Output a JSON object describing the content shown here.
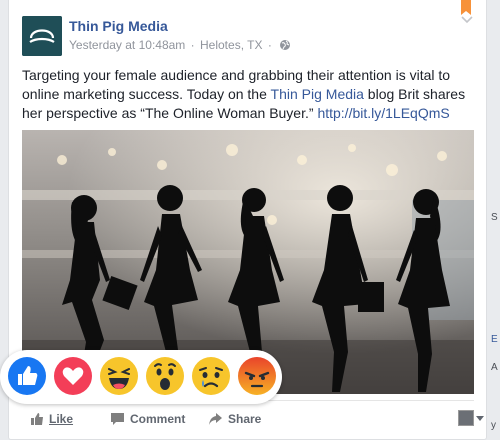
{
  "post": {
    "page_name": "Thin Pig Media",
    "timestamp": "Yesterday at 10:48am",
    "location": "Helotes, TX",
    "separator": "·",
    "privacy_icon": "globe-icon",
    "text_part1": "Targeting your female audience and grabbing their attention is vital to online marketing success. Today on the ",
    "text_link": "Thin Pig Media",
    "text_part2": " blog Brit shares her perspective as “The Online Woman Buyer.” ",
    "url": "http://bit.ly/1LEqQmS"
  },
  "reactions": [
    {
      "name": "like",
      "icon": "thumbs-up-icon",
      "color": "#1877f2"
    },
    {
      "name": "love",
      "icon": "heart-icon",
      "color": "#f33e58"
    },
    {
      "name": "haha",
      "icon": "laughing-face-icon",
      "color": "#f7b125"
    },
    {
      "name": "wow",
      "icon": "surprised-face-icon",
      "color": "#f7b125"
    },
    {
      "name": "sad",
      "icon": "sad-face-icon",
      "color": "#f7b125"
    },
    {
      "name": "angry",
      "icon": "angry-face-icon",
      "color": "#e9710f"
    }
  ],
  "actions": {
    "like": "Like",
    "comment": "Comment",
    "share": "Share"
  },
  "colors": {
    "link": "#365899",
    "meta": "#90949c",
    "action": "#616770",
    "background": "#e9ebee"
  }
}
